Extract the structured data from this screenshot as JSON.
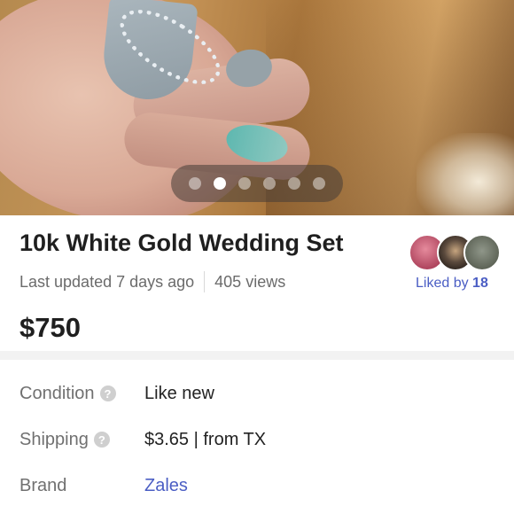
{
  "listing": {
    "title": "10k White Gold Wedding Set",
    "last_updated": "Last updated 7 days ago",
    "views": "405 views",
    "liked_prefix": "Liked by",
    "liked_count": "18",
    "price": "$750"
  },
  "gallery": {
    "image_count": 6,
    "active_index": 1
  },
  "details": {
    "condition_label": "Condition",
    "condition_value": "Like new",
    "shipping_label": "Shipping",
    "shipping_value": "$3.65 | from TX",
    "brand_label": "Brand",
    "brand_value": "Zales"
  },
  "icons": {
    "help": "question-circle-icon"
  },
  "colors": {
    "accent": "#4b5ec4",
    "text_primary": "#1f1f1f",
    "text_secondary": "#6b6b6b"
  }
}
